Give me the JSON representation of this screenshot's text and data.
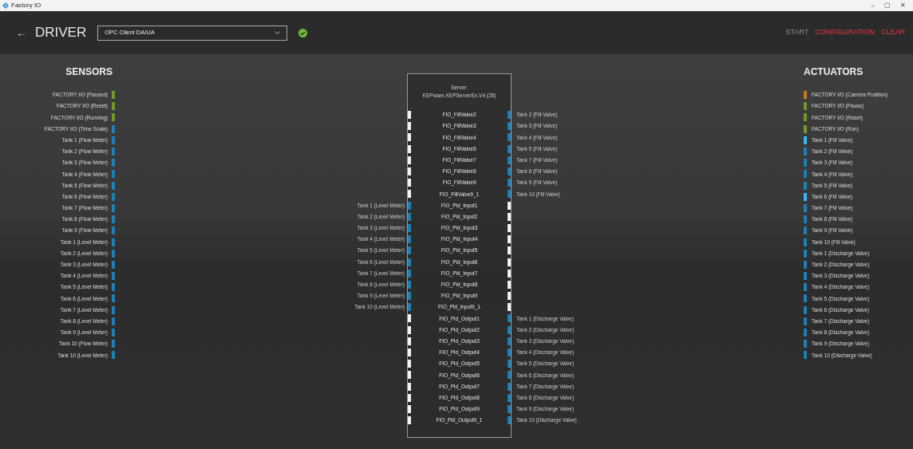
{
  "window": {
    "title": "Factory IO",
    "controls": [
      "–",
      "▢",
      "✕"
    ]
  },
  "header": {
    "back": "←",
    "title": "DRIVER",
    "driver_select": {
      "value": "OPC Client DA/UA"
    },
    "connected": true,
    "actions": [
      {
        "label": "START",
        "disabled": true
      },
      {
        "label": "CONFIGURATION",
        "disabled": false
      },
      {
        "label": "CLEAR",
        "disabled": false
      }
    ]
  },
  "sensors": {
    "title": "SENSORS",
    "items": [
      {
        "label": "FACTORY I/O (Paused)",
        "color": "#6f9a2a"
      },
      {
        "label": "FACTORY I/O (Reset)",
        "color": "#6f9a2a"
      },
      {
        "label": "FACTORY I/O (Running)",
        "color": "#6f9a2a"
      },
      {
        "label": "FACTORY I/O (Time Scale)",
        "color": "#1e7fb5"
      },
      {
        "label": "Tank 1 (Flow Meter)",
        "color": "#1e7fb5"
      },
      {
        "label": "Tank 2 (Flow Meter)",
        "color": "#1e7fb5"
      },
      {
        "label": "Tank 3 (Flow Meter)",
        "color": "#1e7fb5"
      },
      {
        "label": "Tank 4 (Flow Meter)",
        "color": "#1e7fb5"
      },
      {
        "label": "Tank 5 (Flow Meter)",
        "color": "#1e7fb5"
      },
      {
        "label": "Tank 6 (Flow Meter)",
        "color": "#1e7fb5"
      },
      {
        "label": "Tank 7 (Flow Meter)",
        "color": "#1e7fb5"
      },
      {
        "label": "Tank 8 (Flow Meter)",
        "color": "#1e7fb5"
      },
      {
        "label": "Tank 9 (Flow Meter)",
        "color": "#1e7fb5"
      },
      {
        "label": "Tank 1 (Level Meter)",
        "color": "#1e7fb5"
      },
      {
        "label": "Tank 2 (Level Meter)",
        "color": "#1e7fb5"
      },
      {
        "label": "Tank 3 (Level Meter)",
        "color": "#1e7fb5"
      },
      {
        "label": "Tank 4 (Level Meter)",
        "color": "#1e7fb5"
      },
      {
        "label": "Tank 5 (Level Meter)",
        "color": "#1e7fb5"
      },
      {
        "label": "Tank 6 (Level Meter)",
        "color": "#1e7fb5"
      },
      {
        "label": "Tank 7 (Level Meter)",
        "color": "#1e7fb5"
      },
      {
        "label": "Tank 8 (Level Meter)",
        "color": "#1e7fb5"
      },
      {
        "label": "Tank 9 (Level Meter)",
        "color": "#1e7fb5"
      },
      {
        "label": "Tank 10 (Flow Meter)",
        "color": "#1e7fb5"
      },
      {
        "label": "Tank 10 (Level Meter)",
        "color": "#1e7fb5"
      }
    ]
  },
  "server": {
    "title": "Server:",
    "name": "KEPware.KEPServerEx.V4 (28)",
    "rows": [
      {
        "tag": "FIO_FillValve2",
        "left_port": {
          "color": "#f2f2f2"
        },
        "right_port": {
          "color": "#1e7fb5"
        },
        "right_label": "Tank 2 (Fill Valve)"
      },
      {
        "tag": "FIO_FillValve3",
        "left_port": {
          "color": "#f2f2f2"
        },
        "right_port": {
          "color": "#1e7fb5"
        },
        "right_label": "Tank 3 (Fill Valve)"
      },
      {
        "tag": "FIO_FillValve4",
        "left_port": {
          "color": "#f2f2f2"
        },
        "right_port": {
          "color": "#1e7fb5"
        },
        "right_label": "Tank 4 (Fill Valve)"
      },
      {
        "tag": "FIO_FillValve5",
        "left_port": {
          "color": "#f2f2f2"
        },
        "right_port": {
          "color": "#1e7fb5"
        },
        "right_label": "Tank 5 (Fill Valve)"
      },
      {
        "tag": "FIO_FillValve7",
        "left_port": {
          "color": "#f2f2f2"
        },
        "right_port": {
          "color": "#1e7fb5"
        },
        "right_label": "Tank 7 (Fill Valve)"
      },
      {
        "tag": "FIO_FillValve8",
        "left_port": {
          "color": "#f2f2f2"
        },
        "right_port": {
          "color": "#1e7fb5"
        },
        "right_label": "Tank 8 (Fill Valve)"
      },
      {
        "tag": "FIO_FillValve9",
        "left_port": {
          "color": "#f2f2f2"
        },
        "right_port": {
          "color": "#1e7fb5"
        },
        "right_label": "Tank 9 (Fill Valve)"
      },
      {
        "tag": "FIO_FillValve9_1",
        "left_port": {
          "color": "#f2f2f2"
        },
        "right_port": {
          "color": "#1e7fb5"
        },
        "right_label": "Tank 10 (Fill Valve)"
      },
      {
        "left_label": "Tank 1 (Level Meter)",
        "tag": "FIO_Pid_Input1",
        "left_port": {
          "color": "#1e7fb5"
        },
        "right_port": {
          "color": "#f2f2f2"
        }
      },
      {
        "left_label": "Tank 2 (Level Meter)",
        "tag": "FIO_Pid_Input2",
        "left_port": {
          "color": "#1e7fb5"
        },
        "right_port": {
          "color": "#f2f2f2"
        }
      },
      {
        "left_label": "Tank 3 (Level Meter)",
        "tag": "FIO_Pid_Input3",
        "left_port": {
          "color": "#1e7fb5"
        },
        "right_port": {
          "color": "#f2f2f2"
        }
      },
      {
        "left_label": "Tank 4 (Level Meter)",
        "tag": "FIO_Pid_Input4",
        "left_port": {
          "color": "#1e7fb5"
        },
        "right_port": {
          "color": "#f2f2f2"
        }
      },
      {
        "left_label": "Tank 5 (Level Meter)",
        "tag": "FIO_Pid_Input5",
        "left_port": {
          "color": "#1e7fb5"
        },
        "right_port": {
          "color": "#f2f2f2"
        }
      },
      {
        "left_label": "Tank 6 (Level Meter)",
        "tag": "FIO_Pid_Input6",
        "left_port": {
          "color": "#1e7fb5"
        },
        "right_port": {
          "color": "#f2f2f2"
        }
      },
      {
        "left_label": "Tank 7 (Level Meter)",
        "tag": "FIO_Pid_Input7",
        "left_port": {
          "color": "#1e7fb5"
        },
        "right_port": {
          "color": "#f2f2f2"
        }
      },
      {
        "left_label": "Tank 8 (Level Meter)",
        "tag": "FIO_Pid_Input8",
        "left_port": {
          "color": "#1e7fb5"
        },
        "right_port": {
          "color": "#f2f2f2"
        }
      },
      {
        "left_label": "Tank 9 (Level Meter)",
        "tag": "FIO_Pid_Input9",
        "left_port": {
          "color": "#1e7fb5"
        },
        "right_port": {
          "color": "#f2f2f2"
        }
      },
      {
        "left_label": "Tank 10 (Level Meter)",
        "tag": "FIO_Pid_Input9_1",
        "left_port": {
          "color": "#1e7fb5"
        },
        "right_port": {
          "color": "#f2f2f2"
        }
      },
      {
        "tag": "FIO_Pid_Output1",
        "left_port": {
          "color": "#f2f2f2"
        },
        "right_port": {
          "color": "#1e7fb5"
        },
        "right_label": "Tank 1 (Discharge Valve)"
      },
      {
        "tag": "FIO_Pid_Output2",
        "left_port": {
          "color": "#f2f2f2"
        },
        "right_port": {
          "color": "#1e7fb5"
        },
        "right_label": "Tank 2 (Discharge Valve)"
      },
      {
        "tag": "FIO_Pid_Output3",
        "left_port": {
          "color": "#f2f2f2"
        },
        "right_port": {
          "color": "#1e7fb5"
        },
        "right_label": "Tank 3 (Discharge Valve)"
      },
      {
        "tag": "FIO_Pid_Output4",
        "left_port": {
          "color": "#f2f2f2"
        },
        "right_port": {
          "color": "#1e7fb5"
        },
        "right_label": "Tank 4 (Discharge Valve)"
      },
      {
        "tag": "FIO_Pid_Output5",
        "left_port": {
          "color": "#f2f2f2"
        },
        "right_port": {
          "color": "#1e7fb5"
        },
        "right_label": "Tank 5 (Discharge Valve)"
      },
      {
        "tag": "FIO_Pid_Output6",
        "left_port": {
          "color": "#f2f2f2"
        },
        "right_port": {
          "color": "#1e7fb5"
        },
        "right_label": "Tank 6 (Discharge Valve)"
      },
      {
        "tag": "FIO_Pid_Output7",
        "left_port": {
          "color": "#f2f2f2"
        },
        "right_port": {
          "color": "#1e7fb5"
        },
        "right_label": "Tank 7 (Discharge Valve)"
      },
      {
        "tag": "FIO_Pid_Output8",
        "left_port": {
          "color": "#f2f2f2"
        },
        "right_port": {
          "color": "#1e7fb5"
        },
        "right_label": "Tank 8 (Discharge Valve)"
      },
      {
        "tag": "FIO_Pid_Output9",
        "left_port": {
          "color": "#f2f2f2"
        },
        "right_port": {
          "color": "#1e7fb5"
        },
        "right_label": "Tank 9 (Discharge Valve)"
      },
      {
        "tag": "FIO_Pid_Output9_1",
        "left_port": {
          "color": "#f2f2f2"
        },
        "right_port": {
          "color": "#1e7fb5"
        },
        "right_label": "Tank 10 (Discharge Valve)"
      }
    ]
  },
  "actuators": {
    "title": "ACTUATORS",
    "items": [
      {
        "label": "FACTORY I/O (Camera Position)",
        "color": "#c47a1c"
      },
      {
        "label": "FACTORY I/O (Pause)",
        "color": "#6f9a2a"
      },
      {
        "label": "FACTORY I/O (Reset)",
        "color": "#6f9a2a"
      },
      {
        "label": "FACTORY I/O (Run)",
        "color": "#6f9a2a"
      },
      {
        "label": "Tank 1 (Fill Valve)",
        "color": "#3cb4ef"
      },
      {
        "label": "Tank 2 (Fill Valve)",
        "color": "#1e7fb5"
      },
      {
        "label": "Tank 3 (Fill Valve)",
        "color": "#1e7fb5"
      },
      {
        "label": "Tank 4 (Fill Valve)",
        "color": "#1e7fb5"
      },
      {
        "label": "Tank 5 (Fill Valve)",
        "color": "#1e7fb5"
      },
      {
        "label": "Tank 6 (Fill Valve)",
        "color": "#3cb4ef"
      },
      {
        "label": "Tank 7 (Fill Valve)",
        "color": "#1e7fb5"
      },
      {
        "label": "Tank 8 (Fill Valve)",
        "color": "#1e7fb5"
      },
      {
        "label": "Tank 9 (Fill Valve)",
        "color": "#1e7fb5"
      },
      {
        "label": "Tank 10 (Fill Valve)",
        "color": "#1e7fb5"
      },
      {
        "label": "Tank 1 (Discharge Valve)",
        "color": "#1e7fb5"
      },
      {
        "label": "Tank 2 (Discharge Valve)",
        "color": "#1e7fb5"
      },
      {
        "label": "Tank 3 (Discharge Valve)",
        "color": "#1e7fb5"
      },
      {
        "label": "Tank 4 (Discharge Valve)",
        "color": "#1e7fb5"
      },
      {
        "label": "Tank 5 (Discharge Valve)",
        "color": "#1e7fb5"
      },
      {
        "label": "Tank 6 (Discharge Valve)",
        "color": "#1e7fb5"
      },
      {
        "label": "Tank 7 (Discharge Valve)",
        "color": "#1e7fb5"
      },
      {
        "label": "Tank 8 (Discharge Valve)",
        "color": "#1e7fb5"
      },
      {
        "label": "Tank 9 (Discharge Valve)",
        "color": "#1e7fb5"
      },
      {
        "label": "Tank 10 (Discharge Valve)",
        "color": "#1e7fb5"
      }
    ]
  }
}
